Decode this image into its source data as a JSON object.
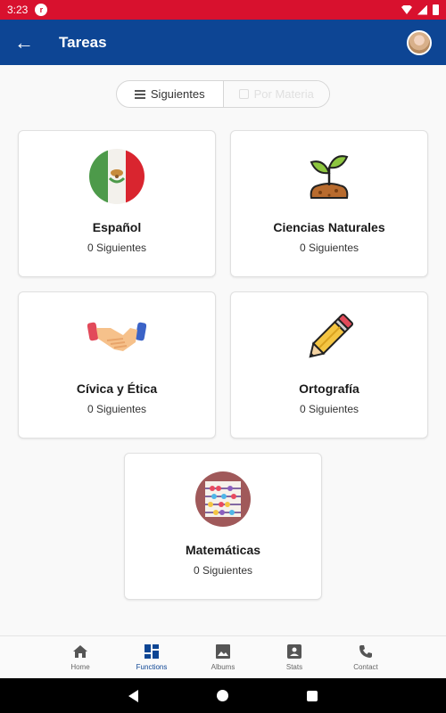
{
  "status_bar": {
    "time": "3:23",
    "app_glyph": "r"
  },
  "app_bar": {
    "title": "Tareas",
    "back_icon": "arrow-left",
    "avatar": "user-avatar"
  },
  "segmented": {
    "options": [
      "Siguientes",
      "Por Materia"
    ],
    "selected": "Siguientes"
  },
  "subjects": [
    {
      "name": "Español",
      "count_label": "0 Siguientes",
      "icon": "mexico-flag-icon"
    },
    {
      "name": "Ciencias Naturales",
      "count_label": "0 Siguientes",
      "icon": "plant-sprout-icon"
    },
    {
      "name": "Cívica y Ética",
      "count_label": "0 Siguientes",
      "icon": "handshake-icon"
    },
    {
      "name": "Ortografía",
      "count_label": "0 Siguientes",
      "icon": "pencil-icon"
    },
    {
      "name": "Matemáticas",
      "count_label": "0 Siguientes",
      "icon": "abacus-icon"
    }
  ],
  "bottom_nav": {
    "items": [
      {
        "label": "Home",
        "icon": "home-icon"
      },
      {
        "label": "Functions",
        "icon": "dashboard-icon"
      },
      {
        "label": "Albums",
        "icon": "image-icon"
      },
      {
        "label": "Stats",
        "icon": "badge-icon"
      },
      {
        "label": "Contact",
        "icon": "phone-icon"
      }
    ],
    "active": "Functions"
  },
  "colors": {
    "status_bar": "#d8112e",
    "app_bar": "#0d4594",
    "active_nav": "#0d4594"
  }
}
